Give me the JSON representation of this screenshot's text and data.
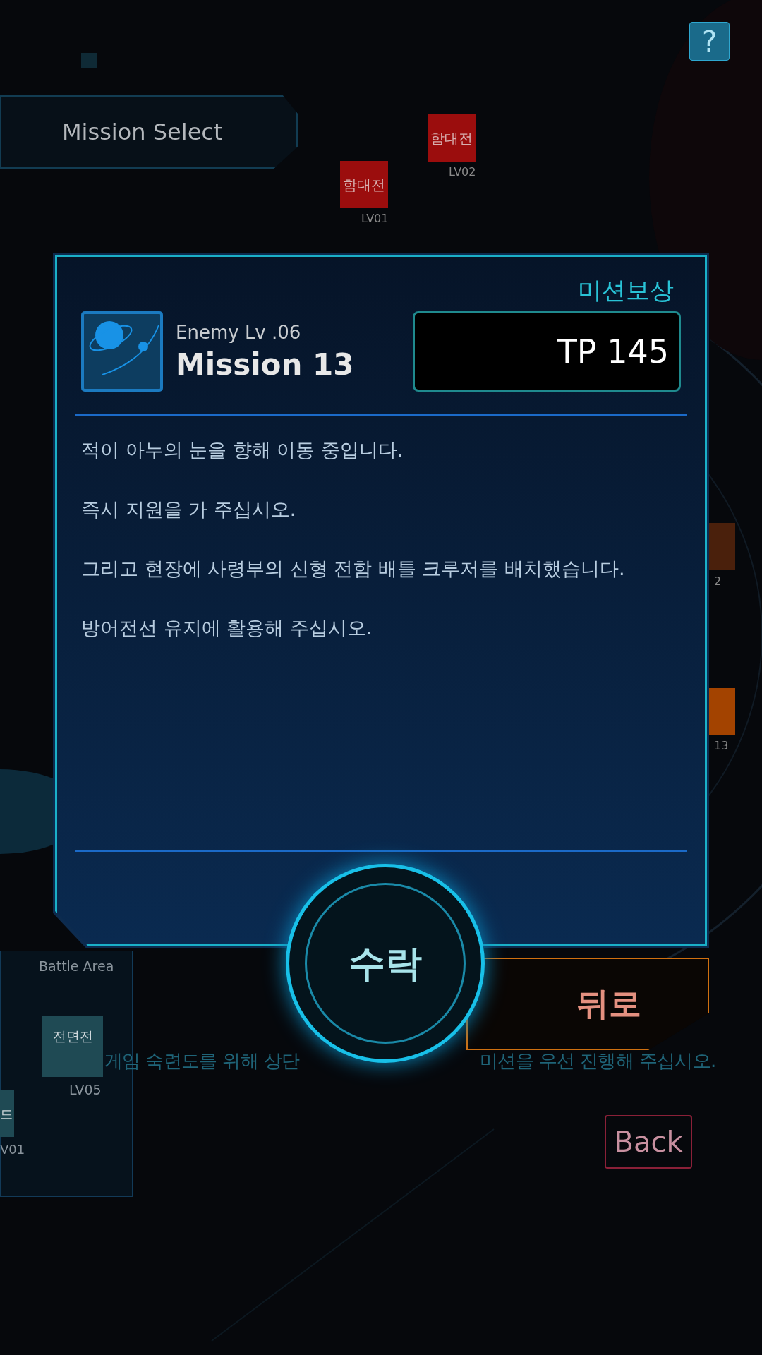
{
  "header": {
    "title": "Mission Select",
    "help_label": "?"
  },
  "map_nodes": [
    {
      "label": "함대전",
      "level": "LV02",
      "color": "#9b0d0d"
    },
    {
      "label": "함대전",
      "level": "LV01",
      "color": "#9b0d0d"
    }
  ],
  "edge_nodes": [
    {
      "level": "2",
      "color": "#4a200c"
    },
    {
      "level": "13",
      "color": "#a34300"
    }
  ],
  "battle_area": {
    "title": "Battle Area",
    "nodes": [
      {
        "label": "전면전",
        "level": "LV05"
      },
      {
        "label": "드",
        "level": "V01"
      }
    ]
  },
  "hint": [
    "게임 숙련도를 위해 상단",
    "미션을 우선 진행해 주십시오."
  ],
  "mission": {
    "reward_label": "미션보상",
    "enemy_level": "Enemy Lv .06",
    "title": "Mission 13",
    "reward": "TP 145",
    "paragraphs": [
      "적이 아누의 눈을 향해 이동 중입니다.",
      "즉시 지원을 가 주십시오.",
      "그리고 현장에 사령부의 신형 전함 배틀 크루저를 배치했습니다.",
      "방어전선 유지에 활용해 주십시오."
    ]
  },
  "buttons": {
    "accept": "수락",
    "back_korean": "뒤로",
    "back": "Back"
  }
}
